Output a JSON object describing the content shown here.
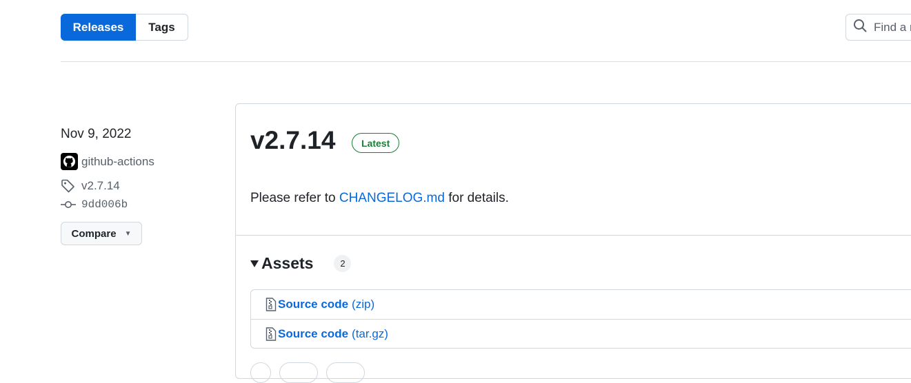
{
  "nav": {
    "releases_tab": "Releases",
    "tags_tab": "Tags",
    "search_placeholder": "Find a release"
  },
  "release": {
    "date": "Nov 9, 2022",
    "author": "github-actions",
    "tag": "v2.7.14",
    "commit": "9dd006b",
    "compare_label": "Compare",
    "title": "v2.7.14",
    "badge": "Latest",
    "body_prefix": "Please refer to",
    "body_link": "CHANGELOG.md",
    "body_suffix": "for details.",
    "assets_label": "Assets",
    "assets_count": "2",
    "assets": [
      {
        "name": "Source code",
        "ext": "(zip)"
      },
      {
        "name": "Source code",
        "ext": "(tar.gz)"
      }
    ]
  },
  "colors": {
    "accent": "#0969da",
    "latest_badge": "#1a7f37",
    "border": "#d0d7de"
  }
}
